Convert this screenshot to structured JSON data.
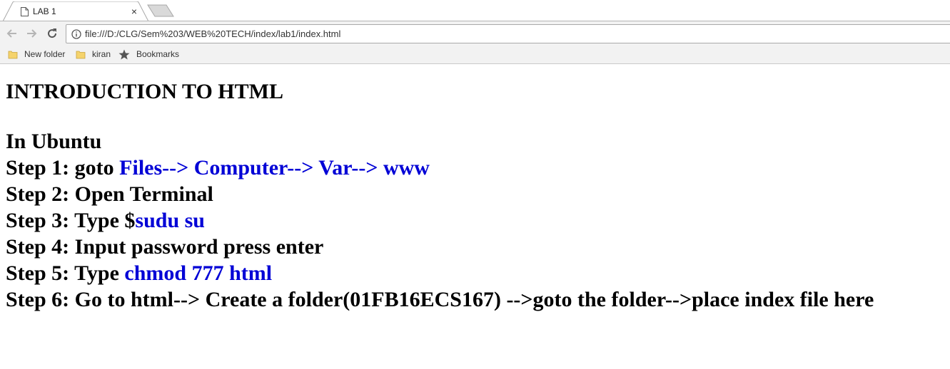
{
  "browser": {
    "tab": {
      "title": "LAB 1",
      "close_glyph": "×"
    },
    "address_bar": {
      "url": "file:///D:/CLG/Sem%203/WEB%20TECH/index/lab1/index.html"
    },
    "bookmarks": [
      {
        "label": "New folder",
        "icon": "folder-icon"
      },
      {
        "label": "kiran",
        "icon": "folder-icon"
      },
      {
        "label": "Bookmarks",
        "icon": "star-icon"
      }
    ],
    "colors": {
      "folder": "#f5d36c",
      "chrome_bg": "#f2f2f2",
      "link_blue": "#0000d6"
    }
  },
  "page": {
    "heading": "INTRODUCTION TO HTML",
    "subheading": "In Ubuntu",
    "steps": [
      {
        "prefix": "Step 1: goto ",
        "highlight": "Files--> Computer--> Var--> www",
        "suffix": ""
      },
      {
        "prefix": "Step 2: Open Terminal",
        "highlight": "",
        "suffix": ""
      },
      {
        "prefix": "Step 3: Type $",
        "highlight": "sudu su",
        "suffix": ""
      },
      {
        "prefix": "Step 4: Input password press enter",
        "highlight": "",
        "suffix": ""
      },
      {
        "prefix": "Step 5: Type ",
        "highlight": "chmod 777 html",
        "suffix": ""
      },
      {
        "prefix": "Step 6: Go to html--> Create a folder(01FB16ECS167) -->goto the folder-->place index file here",
        "highlight": "",
        "suffix": ""
      }
    ]
  }
}
